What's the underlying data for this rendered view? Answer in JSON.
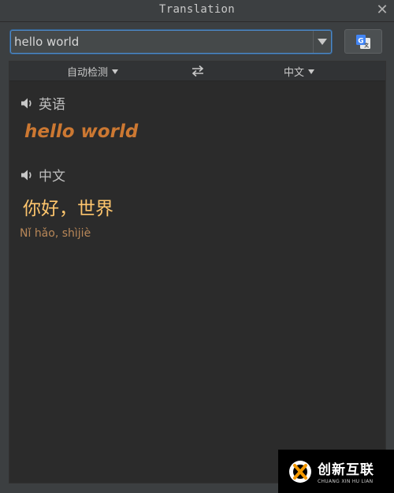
{
  "window": {
    "title": "Translation",
    "close_icon": "close-icon"
  },
  "input": {
    "value": "hello world",
    "dropdown_icon": "chevron-down-icon"
  },
  "translate_button": {
    "icon": "google-translate-icon"
  },
  "language_bar": {
    "source_language": "自动检测",
    "target_language": "中文",
    "swap_icon": "swap-icon"
  },
  "source": {
    "language_label": "英语",
    "text": "hello world",
    "speaker_icon": "speaker-icon"
  },
  "target": {
    "language_label": "中文",
    "text": "你好，世界",
    "pinyin": "Nǐ hǎo, shìjiè",
    "speaker_icon": "speaker-icon"
  },
  "watermark": {
    "name_cn": "创新互联",
    "name_en": "CHUANG XIN HU LIAN"
  },
  "colors": {
    "accent_source": "#cc7832",
    "accent_target": "#ffc66d",
    "pinyin": "#b88758",
    "focus_border": "#4e8ac9"
  }
}
